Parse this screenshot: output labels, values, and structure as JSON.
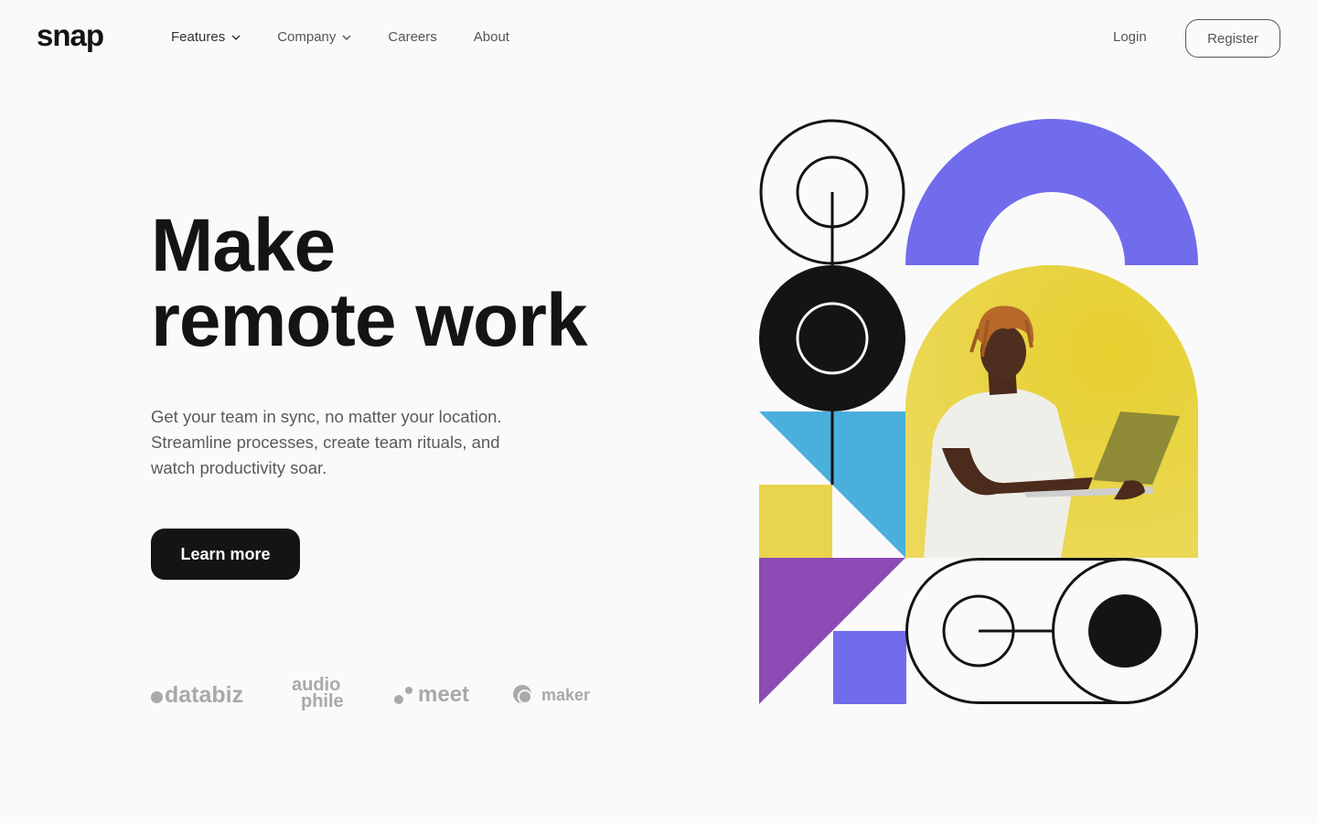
{
  "header": {
    "logo": "snap",
    "nav": [
      {
        "label": "Features",
        "has_dropdown": true
      },
      {
        "label": "Company",
        "has_dropdown": true
      },
      {
        "label": "Careers",
        "has_dropdown": false
      },
      {
        "label": "About",
        "has_dropdown": false
      }
    ],
    "login_label": "Login",
    "register_label": "Register"
  },
  "hero": {
    "title_line1": "Make",
    "title_line2": "remote work",
    "description_lines": [
      "Get your team in sync, no matter your location.",
      "Streamline processes, create team rituals, and",
      "watch productivity soar."
    ],
    "cta_label": "Learn more"
  },
  "clients": {
    "databiz": "databiz",
    "audiophile_line1": "audio",
    "audiophile_line2": "phile",
    "meet": "meet",
    "maker": "maker"
  },
  "colors": {
    "text_dark": "#141414",
    "text_gray": "#5a5a5a",
    "background": "#fafafa",
    "purple": "#716cec",
    "yellow": "#e8d44d",
    "blue": "#4aafdc",
    "violet": "#8c4bb5",
    "logo_gray": "#a9a9a9"
  },
  "illustration": {
    "description": "Geometric shapes with photo of a man holding a laptop on yellow background"
  }
}
